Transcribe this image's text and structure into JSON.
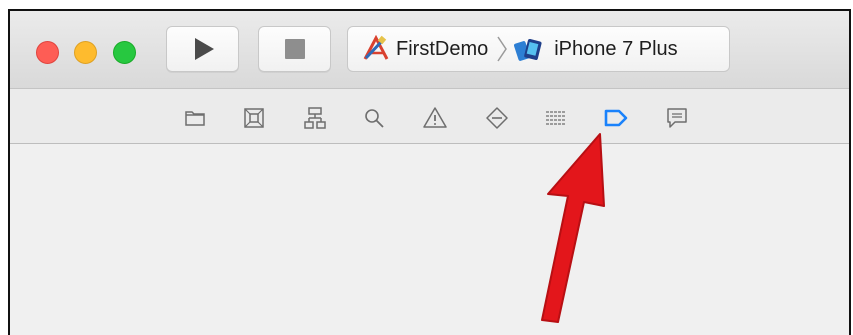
{
  "window": {
    "traffic_lights": [
      "close",
      "minimize",
      "maximize"
    ]
  },
  "toolbar": {
    "run_icon": "play-icon",
    "stop_icon": "stop-icon",
    "scheme": {
      "project": "FirstDemo",
      "device": "iPhone 7 Plus",
      "project_icon": "xcode-app-icon",
      "device_icon": "iphone-simulator-icon"
    }
  },
  "navigator": {
    "tabs": [
      {
        "name": "project-navigator",
        "icon": "folder-icon",
        "selected": false
      },
      {
        "name": "source-control-navigator",
        "icon": "source-control-icon",
        "selected": false
      },
      {
        "name": "symbol-navigator",
        "icon": "hierarchy-icon",
        "selected": false
      },
      {
        "name": "find-navigator",
        "icon": "search-icon",
        "selected": false
      },
      {
        "name": "issue-navigator",
        "icon": "warning-icon",
        "selected": false
      },
      {
        "name": "test-navigator",
        "icon": "diamond-minus-icon",
        "selected": false
      },
      {
        "name": "debug-navigator",
        "icon": "list-lines-icon",
        "selected": false
      },
      {
        "name": "breakpoint-navigator",
        "icon": "breakpoint-icon",
        "selected": true
      },
      {
        "name": "report-navigator",
        "icon": "speech-bubble-icon",
        "selected": false
      }
    ],
    "selected_color": "#1a82fb"
  },
  "annotation": {
    "arrow_color": "#e3161b",
    "arrow_icon": "red-pointer-arrow"
  }
}
